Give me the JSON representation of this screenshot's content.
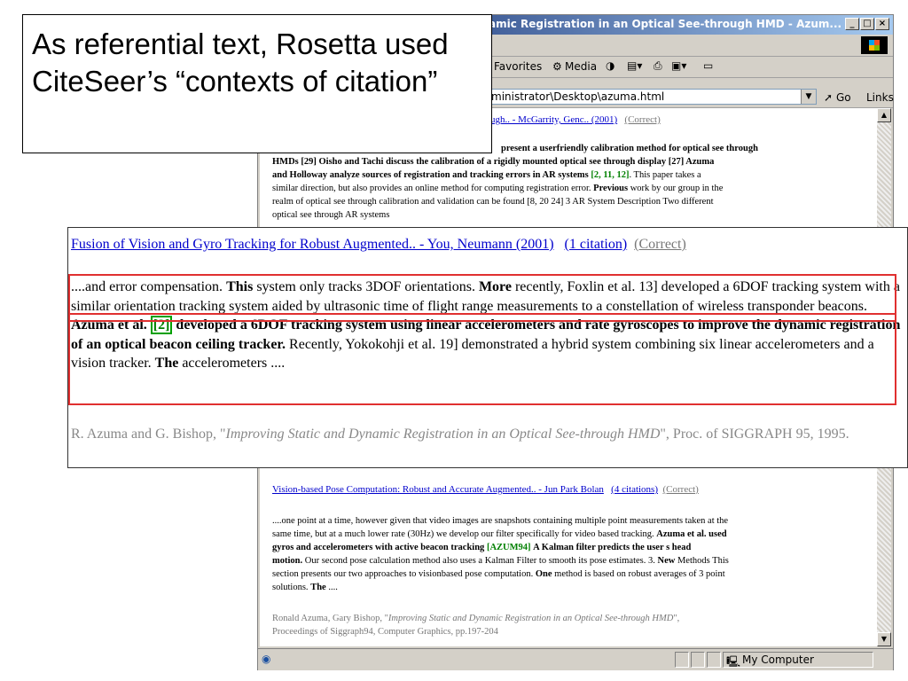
{
  "caption": {
    "text": "As referential text, Rosetta used CiteSeer’s “contexts of citation”"
  },
  "browser": {
    "title": "amic Registration in an Optical See-through HMD - Azum...",
    "menu_favorites": "Favorites",
    "toolbar_media": "Media",
    "address": "ministrator\\Desktop\\azuma.html",
    "go_label": "Go",
    "links_label": "Links",
    "status_zone": "My Computer"
  },
  "content": {
    "top_link": "ugh.. - McGarrity, Genc.. (2001)",
    "top_correct": "(Correct)",
    "p1": {
      "l1": "present a userfriendly calibration method for optical see through",
      "l2": "HMDs [29] Oisho and Tachi discuss the calibration of a rigidly mounted optical see through display [27] Azuma",
      "l3a": "and Holloway analyze sources of registration and tracking errors in AR systems",
      "l3b": "[2, 11, 12]",
      "l3c": ". This paper takes a",
      "l4a": "similar direction, but also provides an online method for computing registration error.",
      "l4b": "Previous",
      "l4c": "work by our group in the",
      "l5": "realm of optical see through calibration and validation can be found [8, 20 24] 3 AR System Description Two different",
      "l6": "optical see through AR systems"
    },
    "second": {
      "link": "Vision-based Pose Computation: Robust and Accurate Augmented.. - Jun Park Bolan",
      "citations": "(4 citations)",
      "correct": "(Correct)",
      "l1": "....one point at a time, however given that video images are snapshots containing multiple point measurements taken at the",
      "l2": "same time, but at a much lower rate (30Hz) we develop our filter specifically for video based tracking.",
      "l2b": "Azuma et al. used",
      "l3a": "gyros and accelerometers with active beacon tracking",
      "l3b": "[",
      "l3c": "AZUM94",
      "l3d": "]",
      "l3e": "A Kalman filter predicts the user s head",
      "l4a": "motion.",
      "l4b": "Our second pose calculation method also uses a Kalman Filter to smooth its pose estimates. 3.",
      "l4c": "New",
      "l4d": "Methods This",
      "l5a": "section presents our two approaches to visionbased pose computation.",
      "l5b": "One",
      "l5c": "method is based on robust averages of 3 point",
      "l6a": "solutions.",
      "l6b": "The",
      "l6c": "....",
      "cite1": "Ronald Azuma, Gary Bishop, \"",
      "cite_title": "Improving Static and Dynamic Registration in an Optical See-through HMD",
      "cite2": "\",",
      "cite3": "Proceedings of Siggraph94, Computer Graphics, pp.197-204"
    }
  },
  "zoom": {
    "link": "Fusion of Vision and Gyro Tracking for Robust Augmented.. - You, Neumann (2001)",
    "citations": "(1 citation)",
    "correct": "(Correct)",
    "t1": "....and error compensation.",
    "t2": "This",
    "t3": "system only tracks 3DOF orientations.",
    "t4": "More",
    "t5": "recently, Foxlin et al. 13] developed a 6DOF tracking system with a similar orientation tracking system aided by ultrasonic time of flight range measurements to a constellation of wireless transponder beacons.",
    "t6": "Azuma et al.",
    "t7": "[2]",
    "t8": "developed a 6DOF tracking system using linear accelerometers and rate gyroscopes to improve the dynamic registration of an optical beacon ceiling tracker.",
    "t9": "Recently, Yokokohji et al. 19] demonstrated a hybrid system combining six linear accelerometers and a vision tracker.",
    "t10": "The",
    "t11": "accelerometers ....",
    "cite1": "R. Azuma and G. Bishop, \"",
    "cite_title": "Improving Static and Dynamic Registration in an Optical See-through HMD",
    "cite2": "\", Proc. of SIGGRAPH 95, 1995."
  }
}
